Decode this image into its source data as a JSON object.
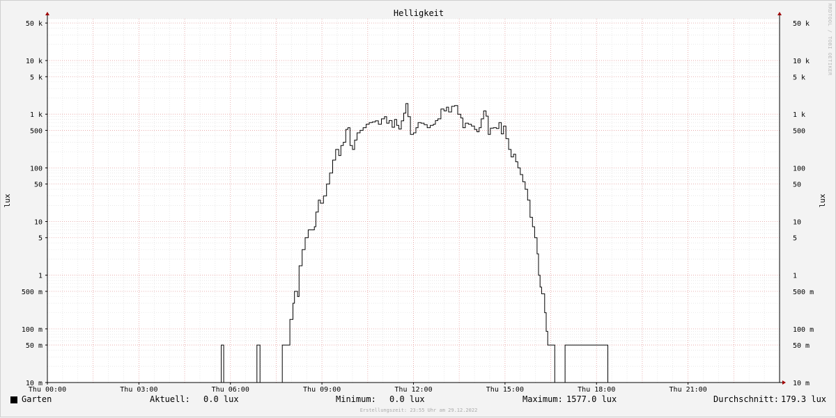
{
  "chart_data": {
    "type": "line",
    "title": "Helligkeit",
    "ylabel": "lux",
    "xlabel": "",
    "y_scale": "log",
    "ylim": [
      0.01,
      60000
    ],
    "x_range_hours": [
      0,
      24
    ],
    "grid": true,
    "x_ticks": [
      {
        "hour": 0,
        "label": "Thu 00:00"
      },
      {
        "hour": 3,
        "label": "Thu 03:00"
      },
      {
        "hour": 6,
        "label": "Thu 06:00"
      },
      {
        "hour": 9,
        "label": "Thu 09:00"
      },
      {
        "hour": 12,
        "label": "Thu 12:00"
      },
      {
        "hour": 15,
        "label": "Thu 15:00"
      },
      {
        "hour": 18,
        "label": "Thu 18:00"
      },
      {
        "hour": 21,
        "label": "Thu 21:00"
      }
    ],
    "y_ticks": [
      {
        "value": 0.01,
        "label": "10 m"
      },
      {
        "value": 0.05,
        "label": "50 m"
      },
      {
        "value": 0.1,
        "label": "100 m"
      },
      {
        "value": 0.5,
        "label": "500 m"
      },
      {
        "value": 1,
        "label": "1"
      },
      {
        "value": 5,
        "label": "5"
      },
      {
        "value": 10,
        "label": "10"
      },
      {
        "value": 50,
        "label": "50"
      },
      {
        "value": 100,
        "label": "100"
      },
      {
        "value": 500,
        "label": "500"
      },
      {
        "value": 1000,
        "label": "1 k"
      },
      {
        "value": 5000,
        "label": "5 k"
      },
      {
        "value": 10000,
        "label": "10 k"
      },
      {
        "value": 50000,
        "label": "50 k"
      }
    ],
    "series": [
      {
        "name": "Garten",
        "color": "#000000",
        "points": [
          [
            0.0,
            0.01
          ],
          [
            5.7,
            0.01
          ],
          [
            5.7,
            0.05
          ],
          [
            5.78,
            0.05
          ],
          [
            5.78,
            0.01
          ],
          [
            6.87,
            0.01
          ],
          [
            6.87,
            0.05
          ],
          [
            6.97,
            0.05
          ],
          [
            6.97,
            0.01
          ],
          [
            7.7,
            0.01
          ],
          [
            7.7,
            0.05
          ],
          [
            7.95,
            0.05
          ],
          [
            7.95,
            0.15
          ],
          [
            8.05,
            0.3
          ],
          [
            8.1,
            0.5
          ],
          [
            8.2,
            0.4
          ],
          [
            8.25,
            1.5
          ],
          [
            8.35,
            3
          ],
          [
            8.45,
            5
          ],
          [
            8.55,
            7
          ],
          [
            8.65,
            7
          ],
          [
            8.75,
            8
          ],
          [
            8.8,
            15
          ],
          [
            8.88,
            25
          ],
          [
            8.95,
            22
          ],
          [
            9.05,
            30
          ],
          [
            9.15,
            50
          ],
          [
            9.25,
            80
          ],
          [
            9.35,
            140
          ],
          [
            9.45,
            220
          ],
          [
            9.55,
            170
          ],
          [
            9.62,
            260
          ],
          [
            9.7,
            300
          ],
          [
            9.78,
            520
          ],
          [
            9.85,
            560
          ],
          [
            9.92,
            260
          ],
          [
            10.0,
            220
          ],
          [
            10.07,
            330
          ],
          [
            10.15,
            450
          ],
          [
            10.25,
            500
          ],
          [
            10.35,
            560
          ],
          [
            10.45,
            650
          ],
          [
            10.55,
            700
          ],
          [
            10.65,
            720
          ],
          [
            10.75,
            750
          ],
          [
            10.85,
            650
          ],
          [
            10.95,
            820
          ],
          [
            11.05,
            900
          ],
          [
            11.12,
            680
          ],
          [
            11.2,
            760
          ],
          [
            11.3,
            570
          ],
          [
            11.38,
            800
          ],
          [
            11.45,
            620
          ],
          [
            11.52,
            530
          ],
          [
            11.6,
            750
          ],
          [
            11.68,
            1050
          ],
          [
            11.75,
            1577
          ],
          [
            11.82,
            900
          ],
          [
            11.9,
            420
          ],
          [
            12.0,
            450
          ],
          [
            12.08,
            560
          ],
          [
            12.15,
            700
          ],
          [
            12.25,
            680
          ],
          [
            12.35,
            640
          ],
          [
            12.45,
            560
          ],
          [
            12.55,
            620
          ],
          [
            12.65,
            650
          ],
          [
            12.72,
            760
          ],
          [
            12.8,
            820
          ],
          [
            12.9,
            1250
          ],
          [
            13.0,
            1150
          ],
          [
            13.08,
            1350
          ],
          [
            13.15,
            1100
          ],
          [
            13.25,
            1400
          ],
          [
            13.35,
            1450
          ],
          [
            13.45,
            1000
          ],
          [
            13.55,
            850
          ],
          [
            13.62,
            560
          ],
          [
            13.7,
            680
          ],
          [
            13.8,
            650
          ],
          [
            13.9,
            600
          ],
          [
            14.0,
            520
          ],
          [
            14.08,
            470
          ],
          [
            14.15,
            560
          ],
          [
            14.22,
            820
          ],
          [
            14.3,
            1150
          ],
          [
            14.38,
            920
          ],
          [
            14.45,
            420
          ],
          [
            14.52,
            550
          ],
          [
            14.62,
            560
          ],
          [
            14.72,
            540
          ],
          [
            14.8,
            700
          ],
          [
            14.88,
            430
          ],
          [
            14.95,
            600
          ],
          [
            15.03,
            350
          ],
          [
            15.12,
            220
          ],
          [
            15.2,
            160
          ],
          [
            15.28,
            180
          ],
          [
            15.35,
            130
          ],
          [
            15.42,
            100
          ],
          [
            15.5,
            75
          ],
          [
            15.58,
            55
          ],
          [
            15.66,
            40
          ],
          [
            15.74,
            25
          ],
          [
            15.82,
            12
          ],
          [
            15.9,
            8
          ],
          [
            15.97,
            5
          ],
          [
            16.05,
            2.5
          ],
          [
            16.1,
            1
          ],
          [
            16.15,
            0.6
          ],
          [
            16.2,
            0.45
          ],
          [
            16.3,
            0.2
          ],
          [
            16.35,
            0.09
          ],
          [
            16.4,
            0.05
          ],
          [
            16.63,
            0.05
          ],
          [
            16.63,
            0.01
          ],
          [
            16.97,
            0.01
          ],
          [
            16.97,
            0.05
          ],
          [
            18.37,
            0.05
          ],
          [
            18.37,
            0.01
          ],
          [
            24.0,
            0.01
          ]
        ]
      }
    ]
  },
  "legend": {
    "series_name": "Garten",
    "current_label": "Aktuell:",
    "current_value": "0.0 lux",
    "min_label": "Minimum:",
    "min_value": "0.0 lux",
    "max_label": "Maximum:",
    "max_value": "1577.0 lux",
    "avg_label": "Durchschnitt:",
    "avg_value": "179.3 lux"
  },
  "footer": {
    "created": "Erstellungszeit: 23:55 Uhr am 29.12.2022"
  },
  "watermark": "RRDTOOL / TOBI OETIKER",
  "colors": {
    "background": "#f3f3f3",
    "plot_area": "#ffffff",
    "major_grid": "#e8a0a0",
    "minor_grid": "#d8d8d8",
    "line": "#000000",
    "axis_arrow": "#a00000"
  }
}
